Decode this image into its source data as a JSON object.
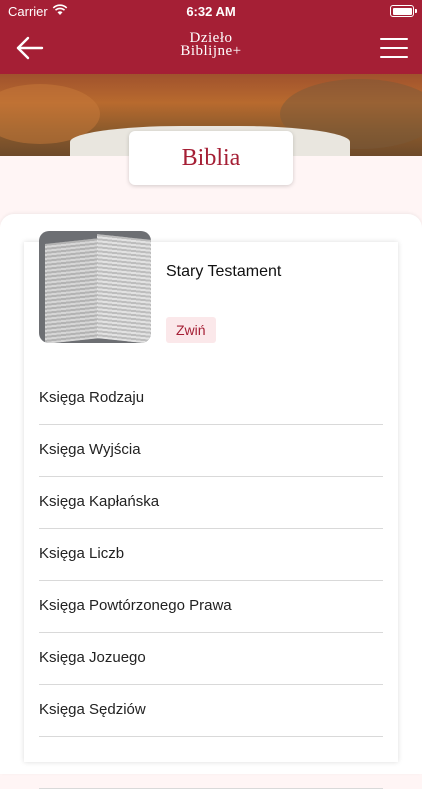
{
  "status_bar": {
    "carrier": "Carrier",
    "time": "6:32 AM"
  },
  "nav": {
    "logo_line1": "Dzieło",
    "logo_line2": "Biblijne+",
    "back_icon": "arrow-left-icon",
    "menu_icon": "hamburger-menu-icon"
  },
  "page": {
    "title": "Biblia"
  },
  "section": {
    "title": "Stary Testament",
    "collapse_label": "Zwiń",
    "books": [
      "Księga Rodzaju",
      "Księga Wyjścia",
      "Księga Kapłańska",
      "Księga Liczb",
      "Księga Powtórzonego Prawa",
      "Księga Jozuego",
      "Księga Sędziów",
      ""
    ]
  },
  "colors": {
    "brand": "#a51f35",
    "collapse_bg": "#fbe8ea"
  }
}
